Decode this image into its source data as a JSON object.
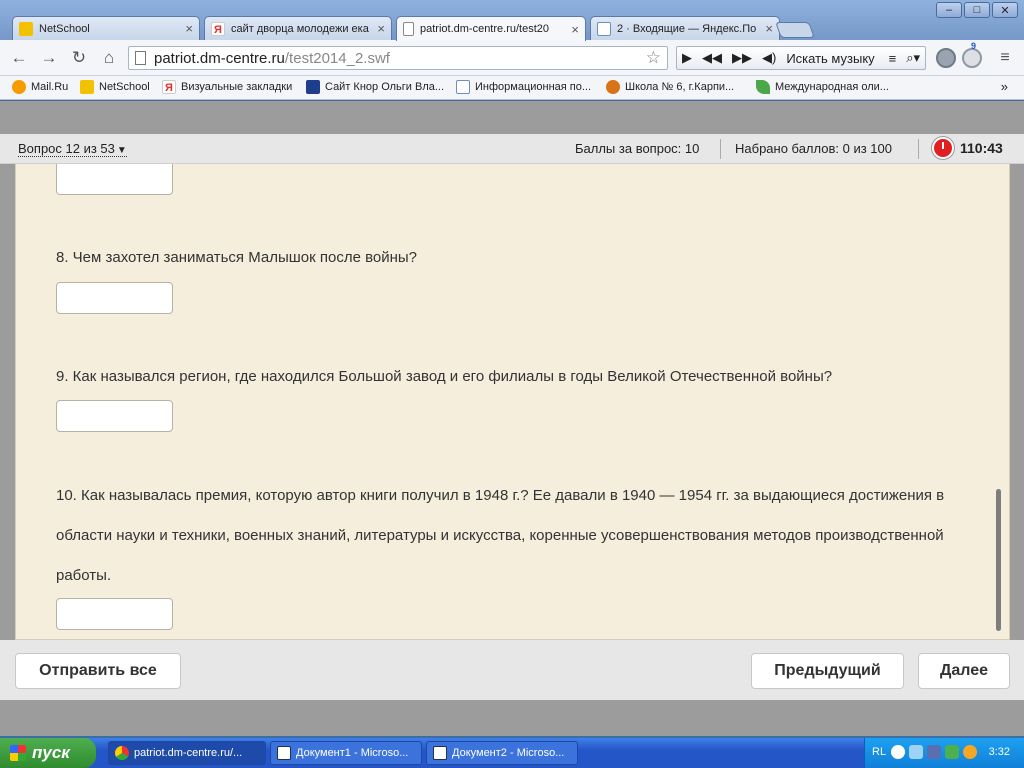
{
  "browser": {
    "tabs": [
      {
        "label": "NetSchool",
        "icon": "netschool-icon",
        "color": "#f2c200"
      },
      {
        "label": "сайт дворца молодежи ека",
        "icon": "yandex-icon",
        "color": "#e4302b"
      },
      {
        "label": "patriot.dm-centre.ru/test20",
        "icon": "page-icon",
        "color": "#ffffff"
      },
      {
        "label": "2 · Входящие — Яндекс.По",
        "icon": "mail-icon",
        "color": "#6b8fc4"
      }
    ],
    "address": {
      "host": "patriot.dm-centre.ru",
      "path": "/test2014_2.swf"
    },
    "music": {
      "label": "Искать музыку"
    },
    "extension_badge": "9",
    "bookmarks": [
      {
        "label": "Mail.Ru",
        "icon": "mailru-icon",
        "color": "#f59b00"
      },
      {
        "label": "NetSchool",
        "icon": "netschool-icon",
        "color": "#f2c200"
      },
      {
        "label": "Визуальные закладки",
        "icon": "yandex-icon",
        "color": "#e4302b"
      },
      {
        "label": "Сайт Кнор Ольги Вла...",
        "icon": "uk-flag-icon",
        "color": "#1f3d8f"
      },
      {
        "label": "Информационная по...",
        "icon": "page-icon",
        "color": "#6b8fc4"
      },
      {
        "label": "Школа № 6, г.Карпи...",
        "icon": "firefox-icon",
        "color": "#d9731a"
      },
      {
        "label": "Международная оли...",
        "icon": "leaf-icon",
        "color": "#4aa84a"
      }
    ],
    "bookmarks_more": "»"
  },
  "test": {
    "question_selector": "Вопрос 12 из 53",
    "points_per_question": "Баллы за вопрос: 10",
    "points_total": "Набрано баллов: 0 из 100",
    "timer": "110:43",
    "questions": [
      {
        "text": "8. Чем захотел заниматься Малышок после войны?"
      },
      {
        "text": "9. Как назывался регион, где находился Большой завод и его филиалы в годы Великой Отечественной войны?"
      },
      {
        "text": "10. Как называлась премия, которую автор книги получил в 1948 г.? Ее давали в 1940 — 1954 гг. за выдающиеся достижения в области науки и техники, военных знаний, литературы и искусства, коренные усовершенствования методов производственной работы."
      }
    ],
    "buttons": {
      "submit_all": "Отправить все",
      "previous": "Предыдущий",
      "next": "Далее"
    }
  },
  "taskbar": {
    "start": "пуск",
    "tasks": [
      {
        "label": "patriot.dm-centre.ru/...",
        "icon": "chrome-icon"
      },
      {
        "label": "Документ1 - Microso...",
        "icon": "word-icon"
      },
      {
        "label": "Документ2 - Microso...",
        "icon": "word-icon"
      }
    ],
    "language": "RL",
    "clock": "3:32"
  }
}
